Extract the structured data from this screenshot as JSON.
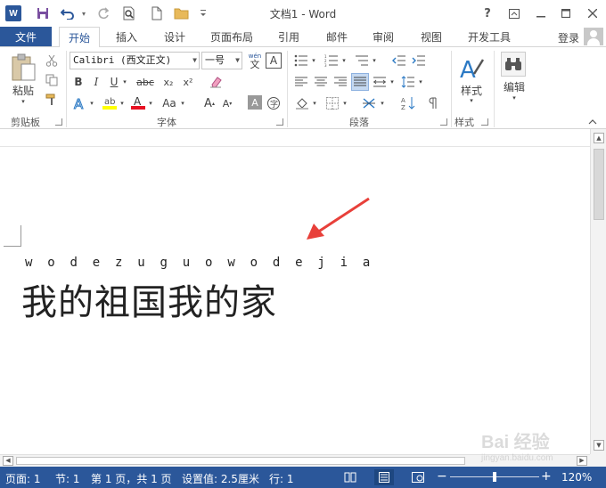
{
  "titlebar": {
    "doc_title": "文档1 - Word",
    "help": "?",
    "icons": [
      "word-logo",
      "save-icon",
      "undo-icon",
      "redo-icon",
      "print-preview-icon",
      "new-doc-icon",
      "open-folder-icon",
      "customize-qat-icon"
    ]
  },
  "tabs": {
    "file": "文件",
    "items": [
      "开始",
      "插入",
      "设计",
      "页面布局",
      "引用",
      "邮件",
      "审阅",
      "视图",
      "开发工具"
    ],
    "active": "开始",
    "login": "登录"
  },
  "ribbon": {
    "clipboard": {
      "paste": "粘贴",
      "label": "剪贴板"
    },
    "font": {
      "font_name": "Calibri (西文正文)",
      "font_size": "一号",
      "wen_glyph": "wén",
      "wen_char": "文",
      "A_box": "A",
      "bold": "B",
      "italic": "I",
      "underline": "U",
      "strike": "abc",
      "sub": "x₂",
      "sup": "x²",
      "grow": "A",
      "shrink": "A",
      "aa": "Aa",
      "label": "字体"
    },
    "paragraph": {
      "label": "段落"
    },
    "styles": {
      "button": "样式",
      "label": "样式"
    },
    "editing": {
      "button": "编辑"
    }
  },
  "document": {
    "pinyin": "w o d e z u g u o w o d e j i a",
    "text": "我的祖国我的家"
  },
  "status": {
    "page": "页面: 1",
    "section": "节: 1",
    "page_of": "第 1 页，共 1 页",
    "position": "设置值: 2.5厘米",
    "line": "行: 1",
    "zoom": "120%"
  },
  "colors": {
    "accent": "#2b579a",
    "arrow": "#e8403a",
    "highlight": "#ffff00",
    "font_color": "#e81123"
  },
  "watermark": {
    "brand": "Bai 经验",
    "site": "jingyan.baidu.com"
  }
}
